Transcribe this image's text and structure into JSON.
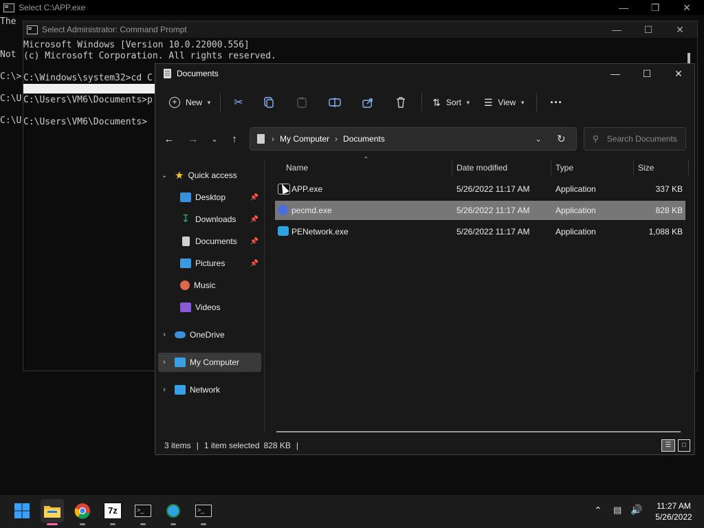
{
  "console_back": {
    "title": "Select C:\\APP.exe",
    "lines": [
      "The",
      "Not",
      "C:\\>",
      "C:\\U",
      "C:\\U"
    ]
  },
  "console_admin": {
    "title": "Select Administrator: Command Prompt",
    "lines": [
      "Microsoft Windows [Version 10.0.22000.556]",
      "(c) Microsoft Corporation. All rights reserved.",
      "C:\\Windows\\system32>cd C",
      "C:\\Users\\VM6\\Documents>p",
      "C:\\Users\\VM6\\Documents>"
    ]
  },
  "explorer": {
    "title": "Documents",
    "toolbar": {
      "new_label": "New",
      "sort_label": "Sort",
      "view_label": "View",
      "more_label": "···"
    },
    "address": {
      "root": "My Computer",
      "sep": "›",
      "current": "Documents"
    },
    "search_placeholder": "Search Documents",
    "nav": {
      "quick_access": "Quick access",
      "items": [
        {
          "label": "Desktop",
          "icon": "desktop-icon",
          "color": "#3a8fd8"
        },
        {
          "label": "Downloads",
          "icon": "download-icon",
          "color": "#2fb37a"
        },
        {
          "label": "Documents",
          "icon": "documents-icon",
          "color": "#cfcfcf"
        },
        {
          "label": "Pictures",
          "icon": "pictures-icon",
          "color": "#3c9be0"
        },
        {
          "label": "Music",
          "icon": "music-icon",
          "color": "#e0684a"
        },
        {
          "label": "Videos",
          "icon": "videos-icon",
          "color": "#8a5ad6"
        }
      ],
      "onedrive": "OneDrive",
      "mycomputer": "My Computer",
      "network": "Network"
    },
    "columns": {
      "name": "Name",
      "date": "Date modified",
      "type": "Type",
      "size": "Size"
    },
    "files": [
      {
        "name": "APP.exe",
        "date": "5/26/2022 11:17 AM",
        "type": "Application",
        "size": "337 KB"
      },
      {
        "name": "pecmd.exe",
        "date": "5/26/2022 11:17 AM",
        "type": "Application",
        "size": "828 KB"
      },
      {
        "name": "PENetwork.exe",
        "date": "5/26/2022 11:17 AM",
        "type": "Application",
        "size": "1,088 KB"
      }
    ],
    "status": {
      "count": "3 items",
      "sep": "|",
      "selected": "1 item selected",
      "size": "828 KB"
    }
  },
  "taskbar": {
    "time": "11:27 AM",
    "date": "5/26/2022",
    "apps": [
      "start-button",
      "file-explorer",
      "chrome",
      "7-zip",
      "cmd-app-1",
      "network-app",
      "cmd-app-2"
    ]
  },
  "colors": {
    "accent": "#0078d4",
    "selection": "#777777",
    "pink_indicator": "#ff6aa8"
  }
}
